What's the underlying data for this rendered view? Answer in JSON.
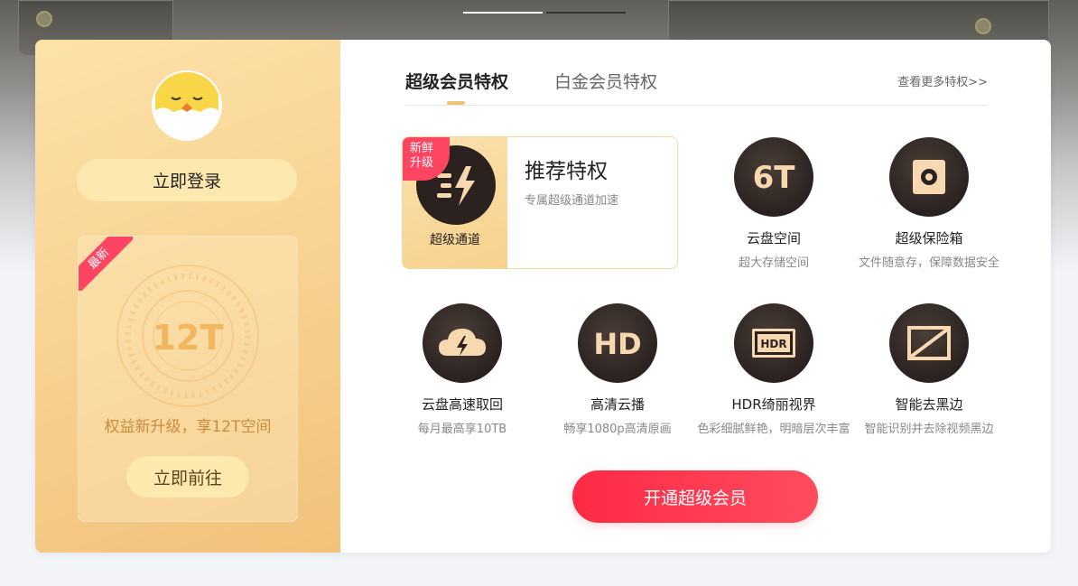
{
  "carousel": {
    "count": 2,
    "active_index": 0
  },
  "left_panel": {
    "login_button": "立即登录",
    "promo": {
      "badge": "最新",
      "capacity": "12T",
      "text": "权益新升级，享12T空间",
      "go_button": "立即前往"
    }
  },
  "tabs": [
    {
      "label": "超级会员特权",
      "active": true
    },
    {
      "label": "白金会员特权",
      "active": false
    }
  ],
  "more_link": "查看更多特权>>",
  "featured": {
    "badge_line1": "新鲜",
    "badge_line2": "升级",
    "icon_label": "超级通道",
    "title": "推荐特权",
    "desc": "专属超级通道加速"
  },
  "privileges": [
    {
      "icon": "6t-storage-icon",
      "icon_text": "6T",
      "name": "云盘空间",
      "sub": "超大存储空间"
    },
    {
      "icon": "safe-box-icon",
      "name": "超级保险箱",
      "sub": "文件随意存，保障数据安全"
    },
    {
      "icon": "cloud-download-icon",
      "name": "云盘高速取回",
      "sub": "每月最高享10TB"
    },
    {
      "icon": "hd-icon",
      "icon_text": "HD",
      "name": "高清云播",
      "sub": "畅享1080p高清原画"
    },
    {
      "icon": "hdr-icon",
      "icon_text": "HDR",
      "name": "HDR绮丽视界",
      "sub": "色彩细腻鲜艳，明暗层次丰富"
    },
    {
      "icon": "remove-black-border-icon",
      "name": "智能去黑边",
      "sub": "智能识别并去除视频黑边"
    }
  ],
  "cta_button": "开通超级会员",
  "colors": {
    "accent_gold": "#f1c27a",
    "cta_red": "#ff2a45",
    "badge_red": "#ff4561",
    "icon_dark": "#2b2220",
    "icon_cream": "#f7d8b0"
  }
}
